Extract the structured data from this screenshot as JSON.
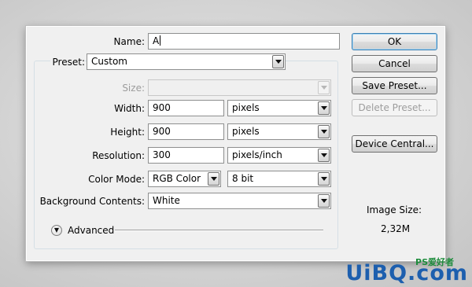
{
  "dialog": {
    "name_label": "Name:",
    "name_value": "A",
    "preset_label": "Preset:",
    "preset_value": "Custom",
    "size_label": "Size:",
    "size_value": "",
    "width_label": "Width:",
    "width_value": "900",
    "width_unit": "pixels",
    "height_label": "Height:",
    "height_value": "900",
    "height_unit": "pixels",
    "resolution_label": "Resolution:",
    "resolution_value": "300",
    "resolution_unit": "pixels/inch",
    "color_mode_label": "Color Mode:",
    "color_mode_value": "RGB Color",
    "bit_depth_value": "8 bit",
    "background_label": "Background Contents:",
    "background_value": "White",
    "advanced_label": "Advanced",
    "advanced_icon": "double-chevron-down-icon"
  },
  "buttons": {
    "ok": "OK",
    "cancel": "Cancel",
    "save_preset": "Save Preset...",
    "delete_preset": "Delete Preset...",
    "device_central": "Device Central..."
  },
  "image_size": {
    "label": "Image Size:",
    "value": "2,32M"
  },
  "watermark": {
    "text": "UiBQ.com",
    "small_text": "PS爱好者"
  },
  "colors": {
    "default_button_border": "#3c7fb1",
    "watermark": "#1d5fae"
  }
}
